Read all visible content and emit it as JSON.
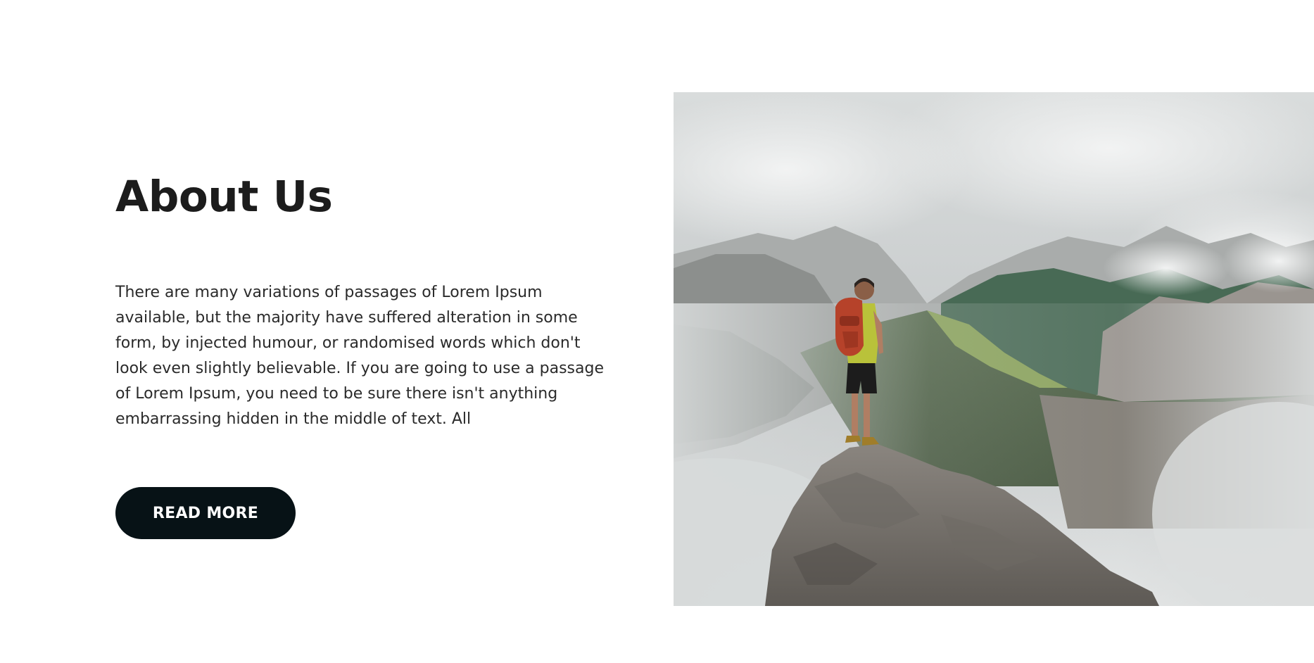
{
  "about": {
    "title": "About Us",
    "paragraph": "There are many variations of passages of Lorem Ipsum\navailable, but the majority have suffered alteration in some\nform, by injected humour, or randomised words which don't\nlook even slightly believable. If you are going to use a passage\nof Lorem Ipsum, you need to be sure there isn't anything\nembarrassing hidden in the middle of text. All",
    "button_label": "READ MORE"
  },
  "colors": {
    "button_background": "#071216",
    "button_text": "#ffffff",
    "heading_text": "#1c1c1c",
    "body_text": "#2a2a2a",
    "page_background": "#ffffff"
  },
  "image": {
    "subject": "hiker with red backpack standing on rocky summit overlooking cloudy mountain valley"
  }
}
